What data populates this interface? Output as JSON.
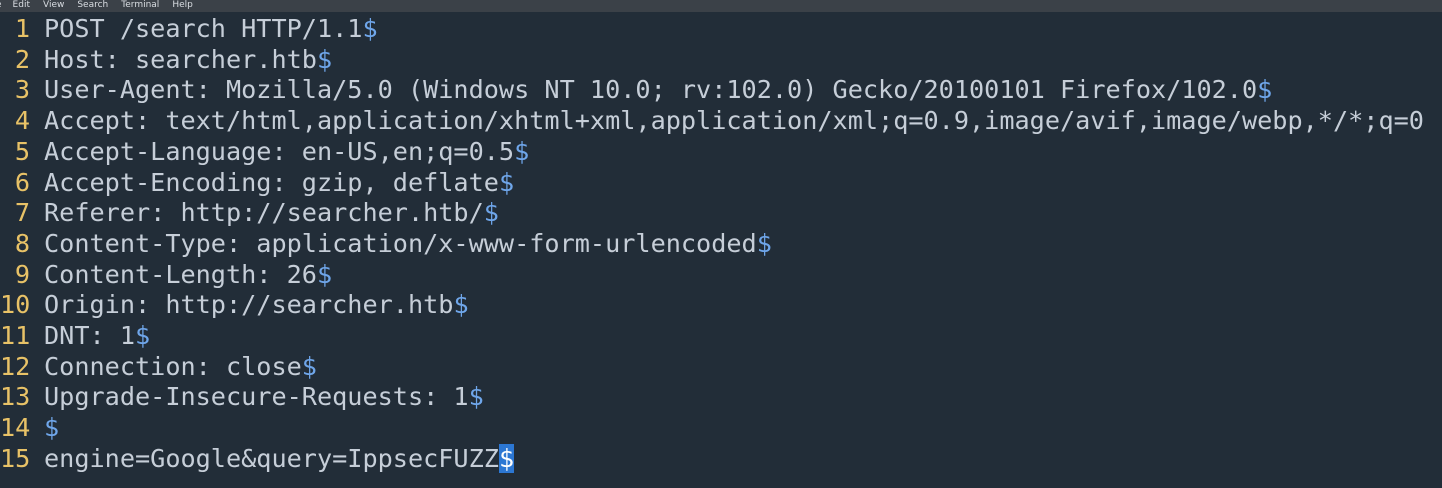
{
  "menu": {
    "items": [
      "e",
      "Edit",
      "View",
      "Search",
      "Terminal",
      "Help"
    ]
  },
  "editor": {
    "eol_marker": "$",
    "lines": [
      {
        "num": "1",
        "text": "POST /search HTTP/1.1",
        "eol": true
      },
      {
        "num": "2",
        "text": "Host: searcher.htb",
        "eol": true
      },
      {
        "num": "3",
        "text": "User-Agent: Mozilla/5.0 (Windows NT 10.0; rv:102.0) Gecko/20100101 Firefox/102.0",
        "eol": true
      },
      {
        "num": "4",
        "text": "Accept: text/html,application/xhtml+xml,application/xml;q=0.9,image/avif,image/webp,*/*;q=0",
        "eol": false
      },
      {
        "num": "5",
        "text": "Accept-Language: en-US,en;q=0.5",
        "eol": true
      },
      {
        "num": "6",
        "text": "Accept-Encoding: gzip, deflate",
        "eol": true
      },
      {
        "num": "7",
        "text": "Referer: http://searcher.htb/",
        "eol": true
      },
      {
        "num": "8",
        "text": "Content-Type: application/x-www-form-urlencoded",
        "eol": true
      },
      {
        "num": "9",
        "text": "Content-Length: 26",
        "eol": true
      },
      {
        "num": "10",
        "text": "Origin: http://searcher.htb",
        "eol": true
      },
      {
        "num": "11",
        "text": "DNT: 1",
        "eol": true
      },
      {
        "num": "12",
        "text": "Connection: close",
        "eol": true
      },
      {
        "num": "13",
        "text": "Upgrade-Insecure-Requests: 1",
        "eol": true
      },
      {
        "num": "14",
        "text": "",
        "eol": true
      },
      {
        "num": "15",
        "text": "engine=Google&query=IppsecFUZZ",
        "eol": true,
        "cursor": true
      }
    ]
  },
  "colors": {
    "background": "#222d38",
    "line_number": "#e8c267",
    "text": "#c6ced8",
    "eol_marker": "#6fa6ea",
    "cursor": "#2c77d3",
    "menubar": "#3b4148"
  }
}
